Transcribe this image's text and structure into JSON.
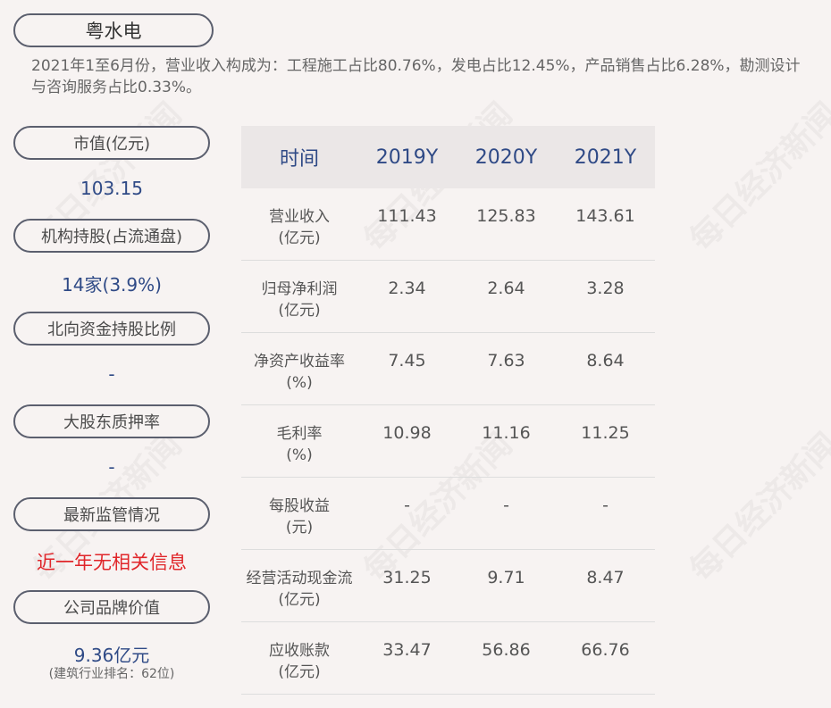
{
  "company": "粤水电",
  "intro": "2021年1至6月份，营业收入构成为：工程施工占比80.76%，发电占比12.45%，产品销售占比6.28%，勘测设计与咨询服务占比0.33%。",
  "left": {
    "market_cap_label": "市值(亿元)",
    "market_cap_value": "103.15",
    "inst_label": "机构持股(占流通盘)",
    "inst_value": "14家(3.9%)",
    "north_label": "北向资金持股比例",
    "north_value": "-",
    "pledge_label": "大股东质押率",
    "pledge_value": "-",
    "regulation_label": "最新监管情况",
    "regulation_value": "近一年无相关信息",
    "brand_label": "公司品牌价值",
    "brand_value": "9.36亿元",
    "brand_sub": "(建筑行业排名：62位)"
  },
  "table": {
    "header": [
      "时间",
      "2019Y",
      "2020Y",
      "2021Y"
    ],
    "rows": [
      {
        "label1": "营业收入",
        "label2": "(亿元)",
        "values": [
          "111.43",
          "125.83",
          "143.61"
        ]
      },
      {
        "label1": "归母净利润",
        "label2": "(亿元)",
        "values": [
          "2.34",
          "2.64",
          "3.28"
        ]
      },
      {
        "label1": "净资产收益率",
        "label2": "(%)",
        "values": [
          "7.45",
          "7.63",
          "8.64"
        ]
      },
      {
        "label1": "毛利率",
        "label2": "(%)",
        "values": [
          "10.98",
          "11.16",
          "11.25"
        ]
      },
      {
        "label1": "每股收益",
        "label2": "(元)",
        "values": [
          "-",
          "-",
          "-"
        ]
      },
      {
        "label1": "经营活动现金流",
        "label2": "(亿元)",
        "values": [
          "31.25",
          "9.71",
          "8.47"
        ]
      },
      {
        "label1": "应收账款",
        "label2": "(亿元)",
        "values": [
          "33.47",
          "56.86",
          "66.76"
        ]
      }
    ]
  },
  "watermark": "每日经济新闻"
}
